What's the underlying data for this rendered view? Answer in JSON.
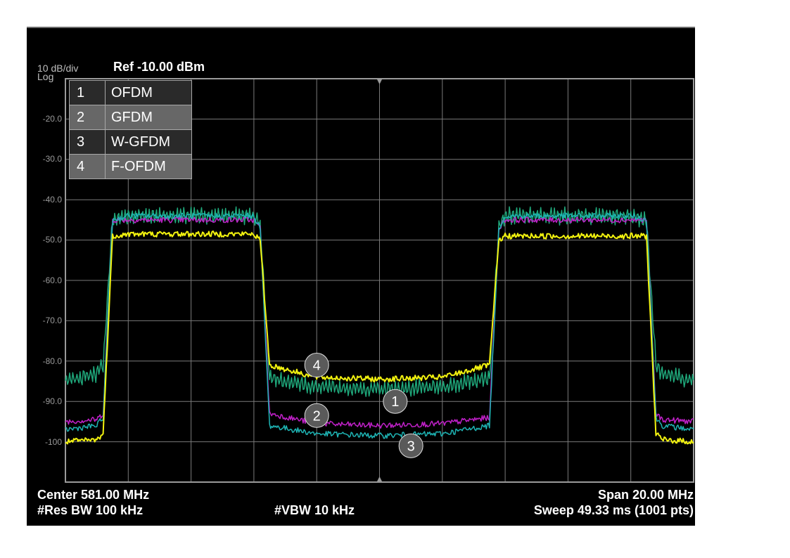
{
  "header": {
    "scale_line1": "10 dB/div",
    "scale_line2": "Log",
    "reference": "Ref -10.00 dBm"
  },
  "footer": {
    "center": "Center 581.00 MHz",
    "span": "Span 20.00 MHz",
    "res_bw": "#Res BW 100 kHz",
    "vbw": "#VBW 10 kHz",
    "sweep": "Sweep  49.33 ms (1001 pts)"
  },
  "legend": [
    {
      "num": "1",
      "name": "OFDM"
    },
    {
      "num": "2",
      "name": "GFDM"
    },
    {
      "num": "3",
      "name": "W-GFDM"
    },
    {
      "num": "4",
      "name": "F-OFDM"
    }
  ],
  "colors": {
    "background": "#000000",
    "grid": "#7a7a7a",
    "OFDM": "#1fa77a",
    "GFDM": "#c020c8",
    "W-GFDM": "#1eb5b5",
    "F-OFDM": "#f2f20f"
  },
  "chart_data": {
    "type": "line",
    "title": "",
    "xlabel": "",
    "ylabel": "",
    "ylim": [
      -110,
      -10
    ],
    "xlim": [
      571,
      591
    ],
    "y_ticks": [
      "-20.0",
      "-30.0",
      "-40.0",
      "-50.0",
      "-60.0",
      "-70.0",
      "-80.0",
      "-90.0",
      "-100"
    ],
    "y_tick_values": [
      -20,
      -30,
      -40,
      -50,
      -60,
      -70,
      -80,
      -90,
      -100
    ],
    "grid": true,
    "x_unit": "MHz",
    "y_unit": "dBm",
    "series": [
      {
        "label": "1",
        "color_key": "OFDM",
        "x": [
          571.0,
          572.0,
          572.2,
          572.5,
          573.0,
          576.0,
          577.0,
          577.2,
          577.5,
          579.0,
          581.0,
          583.0,
          584.5,
          584.8,
          585.0,
          586.0,
          589.0,
          589.5,
          589.8,
          590.0,
          591.0
        ],
        "y": [
          -85,
          -83,
          -81,
          -45,
          -44,
          -44,
          -44,
          -46,
          -84,
          -86.5,
          -87,
          -86.5,
          -84,
          -46,
          -44,
          -44,
          -44,
          -45,
          -81,
          -83,
          -85
        ]
      },
      {
        "label": "2",
        "color_key": "GFDM",
        "x": [
          571.0,
          572.0,
          572.2,
          572.5,
          573.0,
          576.0,
          577.0,
          577.2,
          577.5,
          579.0,
          581.0,
          583.0,
          584.5,
          584.8,
          585.0,
          586.0,
          589.0,
          589.5,
          589.8,
          590.0,
          591.0
        ],
        "y": [
          -95,
          -94.5,
          -93,
          -45,
          -45,
          -45,
          -45,
          -47,
          -93,
          -95.5,
          -96,
          -95.5,
          -94,
          -47,
          -45,
          -45,
          -45,
          -45,
          -93,
          -94.5,
          -95
        ]
      },
      {
        "label": "3",
        "color_key": "W-GFDM",
        "x": [
          571.0,
          572.0,
          572.2,
          572.5,
          573.0,
          576.0,
          577.0,
          577.2,
          577.5,
          579.0,
          581.0,
          583.0,
          584.5,
          584.8,
          585.0,
          586.0,
          589.0,
          589.5,
          589.8,
          590.0,
          591.0
        ],
        "y": [
          -97,
          -96,
          -94,
          -45,
          -44,
          -44,
          -44,
          -47,
          -96,
          -98,
          -98.5,
          -98,
          -96,
          -47,
          -44,
          -44,
          -44,
          -45,
          -94,
          -96,
          -97
        ]
      },
      {
        "label": "4",
        "color_key": "F-OFDM",
        "x": [
          571.0,
          572.0,
          572.2,
          572.5,
          573.0,
          576.0,
          577.0,
          577.2,
          577.5,
          579.0,
          581.0,
          583.0,
          584.5,
          584.8,
          585.0,
          586.0,
          589.0,
          589.5,
          589.8,
          590.0,
          591.0
        ],
        "y": [
          -100,
          -99.5,
          -98,
          -49,
          -48.5,
          -48.5,
          -48.5,
          -50,
          -81,
          -84,
          -84.5,
          -84,
          -81,
          -50,
          -49,
          -49,
          -49,
          -49,
          -98,
          -99.5,
          -100
        ]
      }
    ],
    "markers": [
      {
        "label": "4",
        "x": 579.0,
        "y": -81
      },
      {
        "label": "1",
        "x": 581.5,
        "y": -90
      },
      {
        "label": "2",
        "x": 579.0,
        "y": -93.5
      },
      {
        "label": "3",
        "x": 582.0,
        "y": -101
      }
    ]
  }
}
